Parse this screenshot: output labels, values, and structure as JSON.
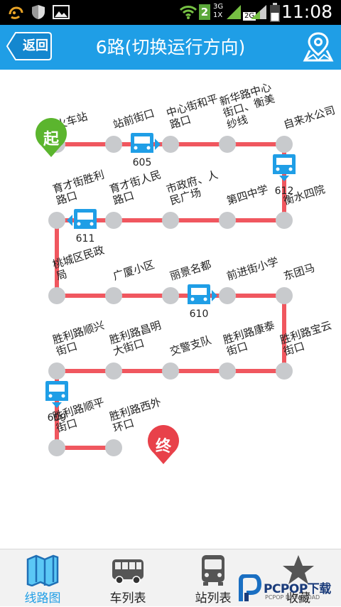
{
  "status_bar": {
    "time": "11:08",
    "sim_badge": "2",
    "net_1": "3G",
    "net_2": "1X",
    "net_3": "2G"
  },
  "header": {
    "back_label": "返回",
    "title": "6路(切换运行方向)",
    "map_icon": "map-pin-icon"
  },
  "route": {
    "start_badge": "起",
    "end_badge": "终",
    "line_color": "#f0575f",
    "stop_color": "#c8cacd",
    "start_color": "#5bb52e",
    "end_color": "#e8414a",
    "bus_color": "#1f9ee6",
    "stops": [
      {
        "name_lines": [
          "火车站"
        ]
      },
      {
        "name_lines": [
          "站前街口"
        ]
      },
      {
        "name_lines": [
          "中心街和平",
          "路口"
        ]
      },
      {
        "name_lines": [
          "新华路中心",
          "街口、衡美",
          "纱线"
        ]
      },
      {
        "name_lines": [
          "自来水公司"
        ]
      },
      {
        "name_lines": [
          "衡水四院"
        ]
      },
      {
        "name_lines": [
          "第四中学"
        ]
      },
      {
        "name_lines": [
          "市政府、人",
          "民广场"
        ]
      },
      {
        "name_lines": [
          "育才街人民",
          "路口"
        ]
      },
      {
        "name_lines": [
          "育才街胜利",
          "路口"
        ]
      },
      {
        "name_lines": [
          "桃城区民政",
          "局"
        ]
      },
      {
        "name_lines": [
          "广厦小区"
        ]
      },
      {
        "name_lines": [
          "丽景名都"
        ]
      },
      {
        "name_lines": [
          "前进街小学"
        ]
      },
      {
        "name_lines": [
          "东团马"
        ]
      },
      {
        "name_lines": [
          "胜利路宝云",
          "街口"
        ]
      },
      {
        "name_lines": [
          "胜利路康泰",
          "街口"
        ]
      },
      {
        "name_lines": [
          "交警支队"
        ]
      },
      {
        "name_lines": [
          "胜利路昌明",
          "大街口"
        ]
      },
      {
        "name_lines": [
          "胜利路顺兴",
          "街口"
        ]
      },
      {
        "name_lines": [
          "胜利路顺平",
          "街口"
        ]
      },
      {
        "name_lines": [
          "胜利路西外",
          "环口"
        ]
      }
    ],
    "buses": [
      {
        "id": "605",
        "segment": "1-2",
        "direction": "right"
      },
      {
        "id": "612",
        "segment": "4-5",
        "direction": "down"
      },
      {
        "id": "611",
        "segment": "8-9",
        "direction": "left"
      },
      {
        "id": "610",
        "segment": "12-13",
        "direction": "right"
      },
      {
        "id": "609",
        "segment": "19-20",
        "direction": "down"
      }
    ]
  },
  "tabbar": {
    "tabs": [
      {
        "label": "线路图",
        "icon": "route-map-icon",
        "active": true
      },
      {
        "label": "车列表",
        "icon": "bus-side-icon",
        "active": false
      },
      {
        "label": "站列表",
        "icon": "bus-front-icon",
        "active": false
      },
      {
        "label": "收藏",
        "icon": "star-icon",
        "active": false
      }
    ]
  },
  "watermark": {
    "brand": "PCPOP下载",
    "sub": "PCPOP DOWNLOAD"
  }
}
